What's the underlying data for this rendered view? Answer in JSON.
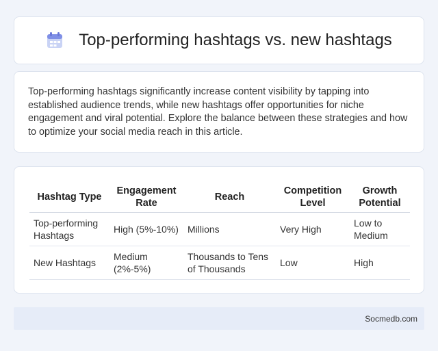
{
  "header": {
    "title": "Top-performing hashtags vs. new hashtags",
    "icon": "calendar-icon"
  },
  "intro": {
    "text": "Top-performing hashtags significantly increase content visibility by tapping into established audience trends, while new hashtags offer opportunities for niche engagement and viral potential. Explore the balance between these strategies and how to optimize your social media reach in this article."
  },
  "table": {
    "headers": [
      "Hashtag Type",
      "Engagement Rate",
      "Reach",
      "Competition Level",
      "Growth Potential"
    ],
    "rows": [
      [
        "Top-performing Hashtags",
        "High (5%-10%)",
        "Millions",
        "Very High",
        "Low to Medium"
      ],
      [
        "New Hashtags",
        "Medium (2%-5%)",
        "Thousands to Tens of Thousands",
        "Low",
        "High"
      ]
    ]
  },
  "footer": {
    "site": "Socmedb.com"
  }
}
